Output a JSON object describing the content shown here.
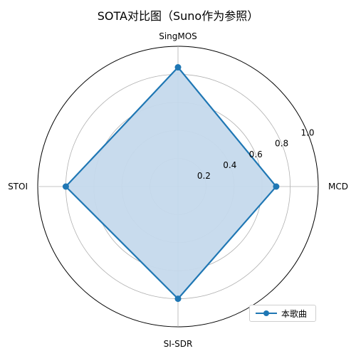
{
  "chart_data": {
    "type": "radar",
    "title": "SOTA对比图（Suno作为参照）",
    "axes": [
      "MCD",
      "SingMOS",
      "STOI",
      "SI-SDR"
    ],
    "rlim": [
      0,
      1.0
    ],
    "rticks": [
      0.2,
      0.4,
      0.6,
      0.8,
      1.0
    ],
    "rtick_labels": [
      "0.2",
      "0.4",
      "0.6",
      "0.8",
      "1.0"
    ],
    "series": [
      {
        "name": "本歌曲",
        "values": [
          0.7,
          0.85,
          0.8,
          0.8
        ]
      }
    ],
    "grid": true,
    "legend": "lower-right",
    "colors": {
      "line": "#1f77b4",
      "fill": "#c5d9ec",
      "grid": "#b0b0b0",
      "frame": "#000000"
    }
  }
}
